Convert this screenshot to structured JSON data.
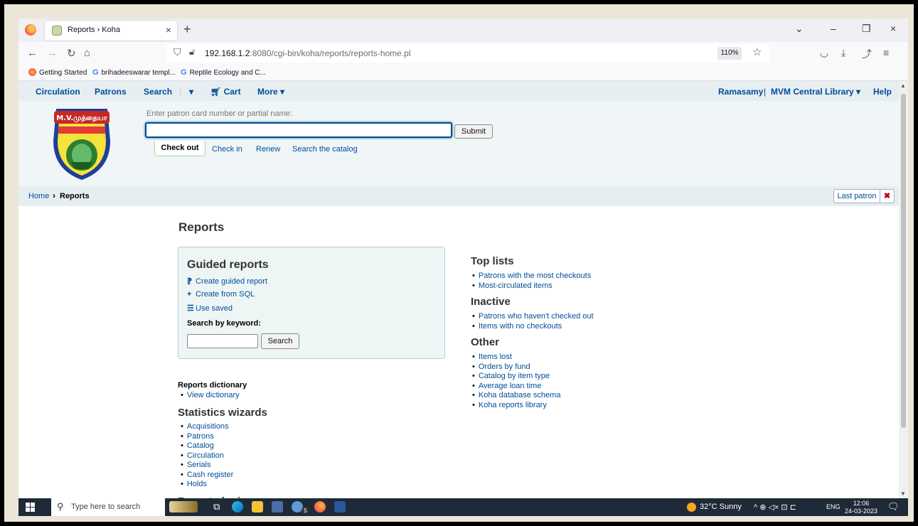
{
  "browser": {
    "tab_title": "Reports › Koha",
    "url_host": "192.168.1.2",
    "url_rest": ":8080/cgi-bin/koha/reports/reports-home.pl",
    "zoom": "110%"
  },
  "bookmarks": [
    {
      "label": "Getting Started"
    },
    {
      "label": "brihadeeswarar templ..."
    },
    {
      "label": "Reptile Ecology and C..."
    }
  ],
  "koha_nav": {
    "circulation": "Circulation",
    "patrons": "Patrons",
    "search": "Search",
    "search_caret": "▾",
    "cart": "Cart",
    "more": "More ▾",
    "user": "Ramasamy",
    "separator": "|",
    "library": "MVM Central Library ▾",
    "help": "Help"
  },
  "logo": {
    "text": "M.V.முத்தையா"
  },
  "checkout": {
    "label": "Enter patron card number or partial name:",
    "input_value": "",
    "submit": "Submit",
    "tab_active": "Check out",
    "links": [
      "Check in",
      "Renew",
      "Search the catalog"
    ]
  },
  "breadcrumb": {
    "home": "Home",
    "current": "Reports",
    "last_patron": "Last patron"
  },
  "reports": {
    "title": "Reports",
    "guided": {
      "title": "Guided reports",
      "create_guided": "Create guided report",
      "create_sql": "Create from SQL",
      "use_saved": "Use saved",
      "keyword_label": "Search by keyword:",
      "search_value": "",
      "search_button": "Search"
    },
    "dictionary": {
      "title": "Reports dictionary",
      "items": [
        "View dictionary"
      ]
    },
    "statistics": {
      "title": "Statistics wizards",
      "items": [
        "Acquisitions",
        "Patrons",
        "Catalog",
        "Circulation",
        "Serials",
        "Cash register",
        "Holds"
      ]
    },
    "plugins": {
      "title": "Report plugins"
    },
    "top_lists": {
      "title": "Top lists",
      "items": [
        "Patrons with the most checkouts",
        "Most-circulated items"
      ]
    },
    "inactive": {
      "title": "Inactive",
      "items": [
        "Patrons who haven't checked out",
        "Items with no checkouts"
      ]
    },
    "other": {
      "title": "Other",
      "items": [
        "Items lost",
        "Orders by fund",
        "Catalog by item type",
        "Average loan time",
        "Koha database schema",
        "Koha reports library"
      ]
    }
  },
  "taskbar": {
    "search_placeholder": "Type here to search",
    "badge": "5",
    "weather": "32°C  Sunny",
    "lang": "ENG",
    "time": "12:06",
    "date": "24-03-2023"
  },
  "colors": {
    "link": "#004d99",
    "koha_header": "#e7eef2",
    "taskbar": "#1f2a38"
  }
}
